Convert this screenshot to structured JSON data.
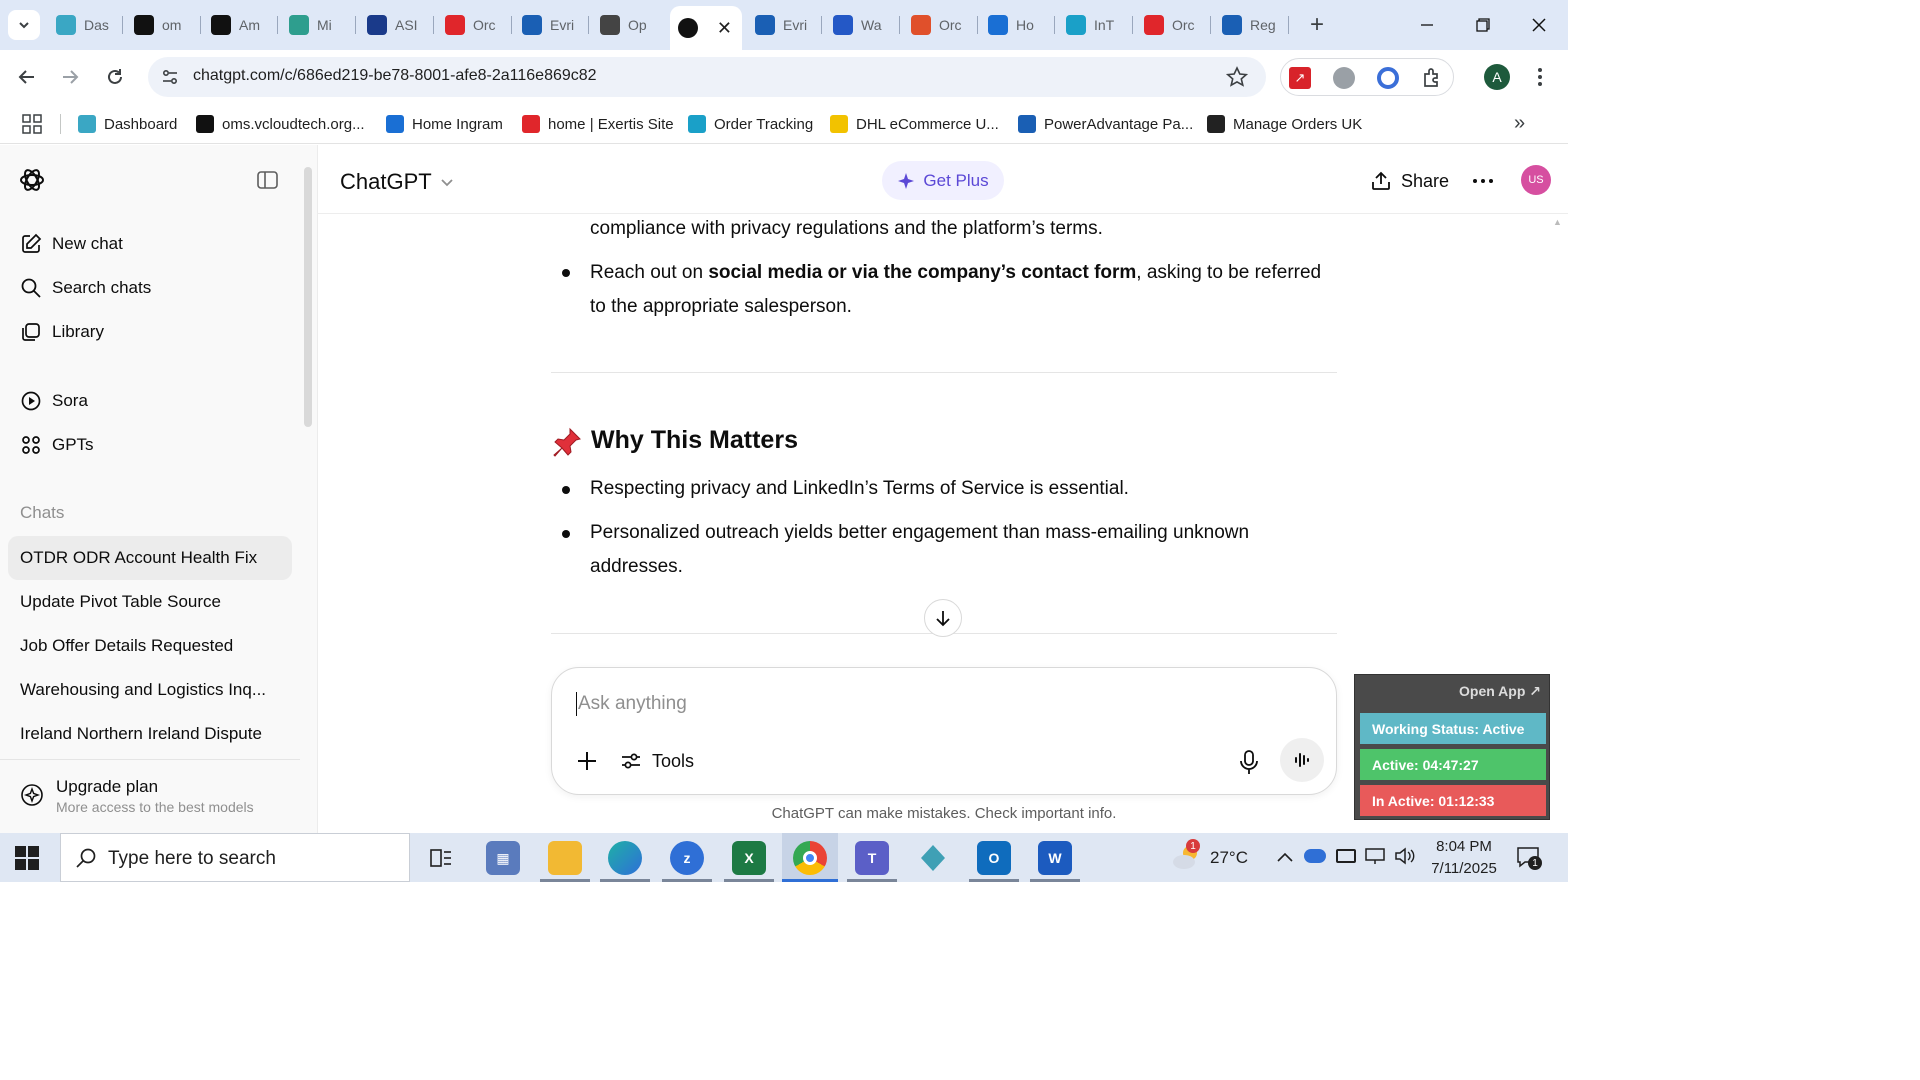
{
  "browser": {
    "tabs": [
      {
        "label": "Das",
        "icon": "dashboard-icon",
        "color": "#3aa7c4"
      },
      {
        "label": "om",
        "icon": "oms-icon",
        "color": "#111111"
      },
      {
        "label": "Am",
        "icon": "amazon-icon",
        "color": "#111111"
      },
      {
        "label": "Mi",
        "icon": "mi-icon",
        "color": "#2e9e8e"
      },
      {
        "label": "ASI",
        "icon": "asi-icon",
        "color": "#1a3a8a"
      },
      {
        "label": "Orc",
        "icon": "exertis-icon",
        "color": "#e0262b"
      },
      {
        "label": "Evri",
        "icon": "evri-e-icon",
        "color": "#1a5fb4"
      },
      {
        "label": "Op",
        "icon": "openai-icon",
        "color": "#444444"
      },
      {
        "label": "",
        "icon": "chatgpt-icon",
        "color": "#111111",
        "active": true
      },
      {
        "label": "Evri",
        "icon": "evri-e-icon",
        "color": "#1a5fb4"
      },
      {
        "label": "Wa",
        "icon": "chart-bars-icon",
        "color": "#2458c6"
      },
      {
        "label": "Orc",
        "icon": "orc-icon",
        "color": "#e0502b"
      },
      {
        "label": "Ho",
        "icon": "ingram-icon",
        "color": "#1a6fd4"
      },
      {
        "label": "InT",
        "icon": "int-icon",
        "color": "#1aa0c8"
      },
      {
        "label": "Orc",
        "icon": "exertis-icon",
        "color": "#e0262b"
      },
      {
        "label": "Reg",
        "icon": "powerad-icon",
        "color": "#1a5fb4"
      }
    ],
    "url": "chatgpt.com/c/686ed219-be78-8001-afe8-2a116e869c82",
    "profile_initial": "A",
    "bookmarks": [
      {
        "label": "Dashboard",
        "color": "#3aa7c4"
      },
      {
        "label": "oms.vcloudtech.org...",
        "color": "#111111"
      },
      {
        "label": "Home Ingram",
        "color": "#1a6fd4"
      },
      {
        "label": "home | Exertis Site",
        "color": "#e0262b"
      },
      {
        "label": "Order Tracking",
        "color": "#1aa0c8"
      },
      {
        "label": "DHL eCommerce U...",
        "color": "#f2c200"
      },
      {
        "label": "PowerAdvantage Pa...",
        "color": "#1a5fb4"
      },
      {
        "label": "Manage Orders UK",
        "color": "#222222"
      }
    ]
  },
  "sidebar": {
    "new_chat": "New chat",
    "search_chats": "Search chats",
    "library": "Library",
    "sora": "Sora",
    "gpts": "GPTs",
    "chats_heading": "Chats",
    "chats": [
      "OTDR ODR Account Health Fix",
      "Update Pivot Table Source",
      "Job Offer Details Requested",
      "Warehousing and Logistics Inq...",
      "Ireland Northern Ireland Dispute"
    ],
    "upgrade_title": "Upgrade plan",
    "upgrade_sub": "More access to the best models"
  },
  "header": {
    "model": "ChatGPT",
    "get_plus": "Get Plus",
    "share": "Share",
    "avatar": "US"
  },
  "conversation": {
    "line_top": "compliance with privacy regulations and the platform’s terms.",
    "bullet2_pre": "Reach out on ",
    "bullet2_bold": "social media or via the company’s contact form",
    "bullet2_post": ", asking to be referred",
    "bullet2_line2": "to the appropriate salesperson.",
    "section_title": "Why This Matters",
    "bullets": [
      "Respecting privacy and LinkedIn’s Terms of Service is essential.",
      "Personalized outreach yields better engagement than mass-emailing unknown",
      "addresses."
    ]
  },
  "composer": {
    "placeholder": "Ask anything",
    "tools": "Tools",
    "disclaimer": "ChatGPT can make mistakes. Check important info."
  },
  "widget": {
    "open_app": "Open App ↗",
    "working_status": "Working Status: Active",
    "active": "Active: 04:47:27",
    "inactive": "In Active: 01:12:33"
  },
  "taskbar": {
    "search_placeholder": "Type here to search",
    "temperature": "27°C",
    "time": "8:04 PM",
    "date": "7/11/2025",
    "notifications": "1"
  }
}
